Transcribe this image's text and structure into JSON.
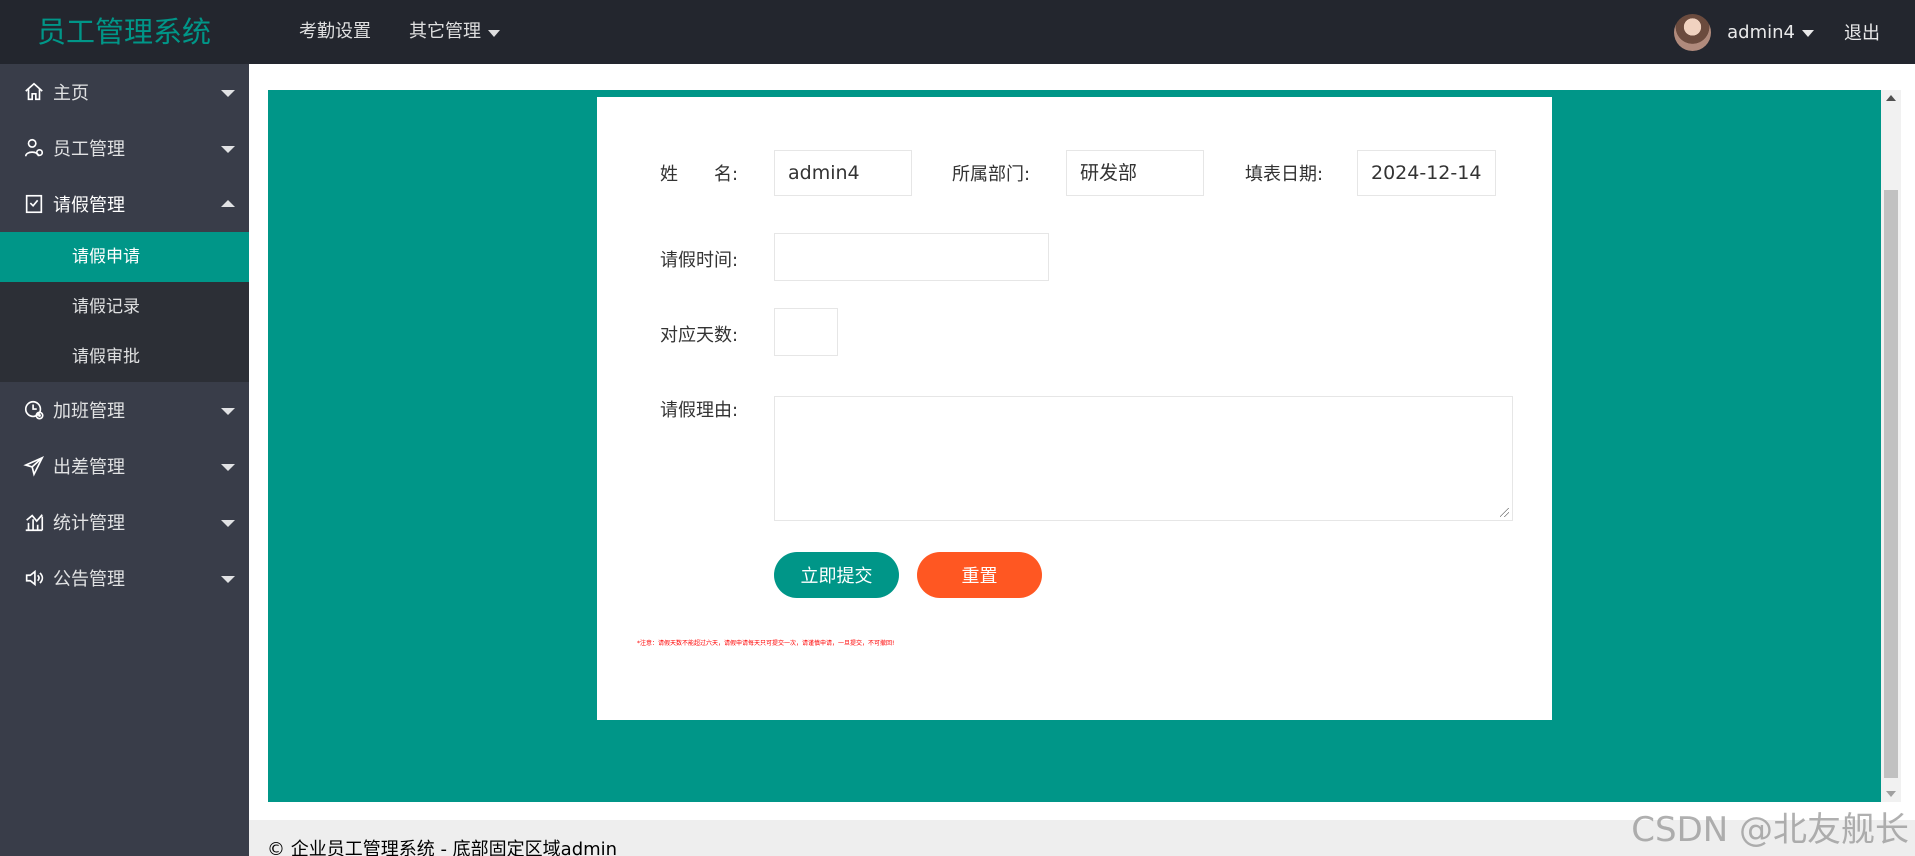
{
  "header": {
    "brand": "员工管理系统",
    "nav": [
      {
        "label": "考勤设置"
      },
      {
        "label": "其它管理"
      }
    ],
    "username": "admin4",
    "logout": "退出"
  },
  "sidebar": {
    "items": [
      {
        "label": "主页",
        "icon": "home-icon"
      },
      {
        "label": "员工管理",
        "icon": "user-icon"
      },
      {
        "label": "请假管理",
        "icon": "form-icon",
        "open": true
      },
      {
        "label": "加班管理",
        "icon": "clock-add-icon"
      },
      {
        "label": "出差管理",
        "icon": "plane-icon"
      },
      {
        "label": "统计管理",
        "icon": "chart-icon"
      },
      {
        "label": "公告管理",
        "icon": "speaker-icon"
      }
    ],
    "leave_submenu": [
      {
        "label": "请假申请",
        "active": true
      },
      {
        "label": "请假记录"
      },
      {
        "label": "请假审批"
      }
    ]
  },
  "form": {
    "name_label": "姓　　名:",
    "name_value": "admin4",
    "dept_label": "所属部门:",
    "dept_value": "研发部",
    "date_label": "填表日期:",
    "date_value": "2024-12-14",
    "time_label": "请假时间:",
    "time_value": "",
    "days_label": "对应天数:",
    "days_value": "",
    "reason_label": "请假理由:",
    "reason_value": "",
    "submit_label": "立即提交",
    "reset_label": "重置",
    "note": "*注意：请假天数不能超过六天，请假申请每天只可提交一次，请谨慎申请，一旦提交，不可撤回!"
  },
  "footer": {
    "text": "© 企业员工管理系统 - 底部固定区域admin"
  },
  "watermark": "CSDN @北友舰长",
  "colors": {
    "header_bg": "#23262e",
    "sidebar_bg": "#393d49",
    "accent": "#009688",
    "reset": "#ff5722"
  }
}
